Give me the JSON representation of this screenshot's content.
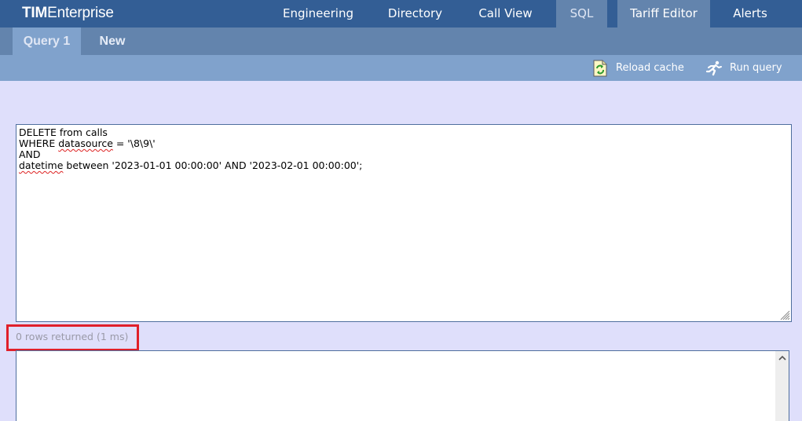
{
  "app": {
    "logo_bold": "TIM",
    "logo_light": "Enterprise"
  },
  "nav": {
    "tabs": [
      {
        "label": "Engineering",
        "state": "normal"
      },
      {
        "label": "Directory",
        "state": "normal"
      },
      {
        "label": "Call View",
        "state": "normal"
      },
      {
        "label": "SQL",
        "state": "active"
      },
      {
        "label": "Tariff Editor",
        "state": "hover"
      },
      {
        "label": "Alerts",
        "state": "normal"
      }
    ]
  },
  "subtabs": [
    {
      "label": "Query 1",
      "active": true
    },
    {
      "label": "New",
      "active": false
    }
  ],
  "toolbar": {
    "reload_label": "Reload cache",
    "reload_icon": "reload-cache-icon",
    "run_label": "Run query",
    "run_icon": "running-man-icon"
  },
  "editor": {
    "lines": [
      "DELETE from calls",
      "WHERE datasource = '\\8\\9\\'",
      "AND",
      "datetime between '2023-01-01 00:00:00' AND '2023-02-01 00:00:00';"
    ],
    "line2_prefix": "WHERE ",
    "line2_misspelled": "datasource",
    "line2_suffix": " = '\\8\\9\\'",
    "line4_misspelled": "datetime",
    "line4_suffix": " between '2023-01-01 00:00:00' AND '2023-02-01 00:00:00';"
  },
  "status": {
    "text": "0 rows returned (1 ms)"
  },
  "colors": {
    "topbar": "#335e95",
    "subbar": "#6384ad",
    "toolbar": "#80a2cc",
    "page_bg": "#dfdffb",
    "highlight": "#e0202a"
  }
}
